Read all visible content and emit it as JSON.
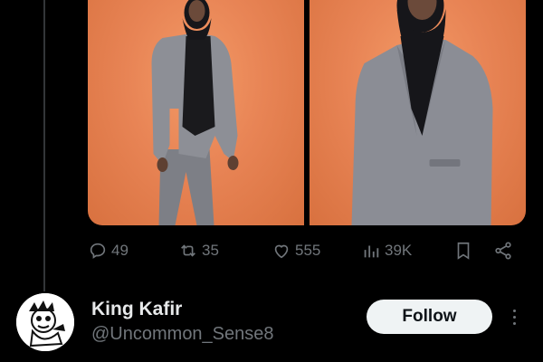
{
  "post": {
    "media": [
      {
        "icon": "photo-woman-suit-full"
      },
      {
        "icon": "photo-woman-suit-close"
      }
    ],
    "actions": {
      "replies": "49",
      "reposts": "35",
      "likes": "555",
      "views": "39K"
    }
  },
  "who_to_follow": {
    "name": "King Kafir",
    "handle": "@Uncommon_Sense8",
    "follow_label": "Follow"
  },
  "colors": {
    "background": "#000000",
    "muted": "#71767b",
    "photo_backdrop": "#e88455",
    "button_bg": "#eff3f4"
  }
}
